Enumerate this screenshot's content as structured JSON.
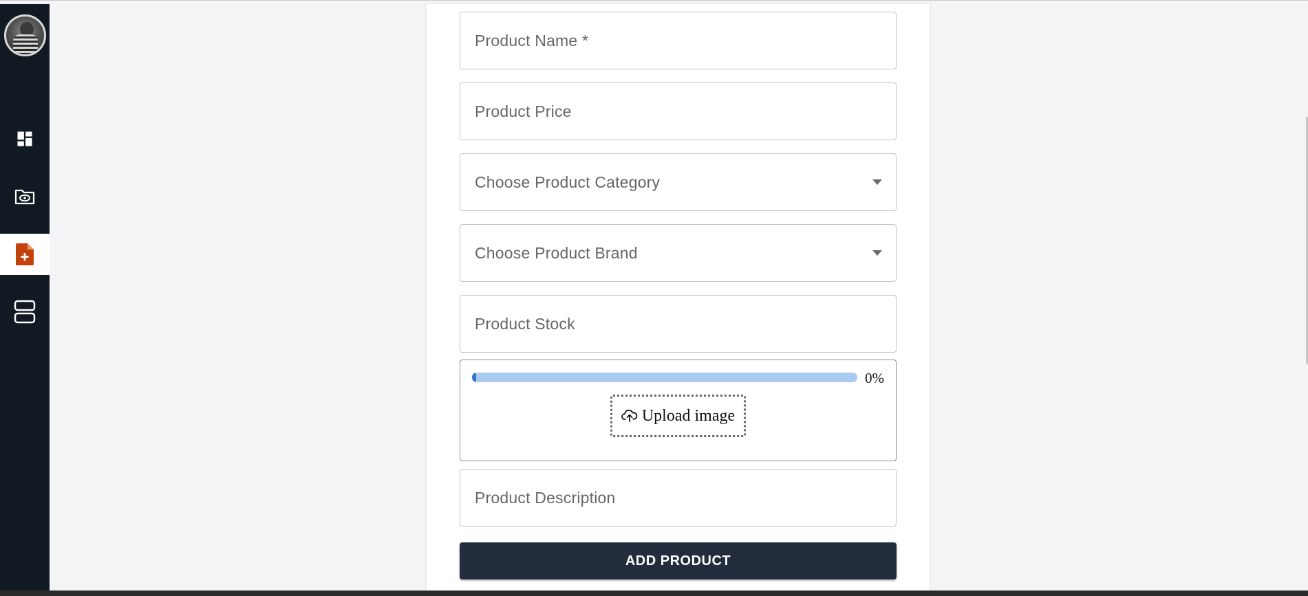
{
  "colors": {
    "sidebar_bg": "#111a22",
    "page_bg": "#f3f4f6",
    "active_icon": "#c2410c",
    "button_bg": "#232d3d",
    "progress_track": "#a9cbef",
    "progress_fill": "#2e73c8"
  },
  "sidebar": {
    "items": [
      {
        "icon": "dashboard-icon",
        "active": false
      },
      {
        "icon": "folder-eye-icon",
        "active": false
      },
      {
        "icon": "add-document-icon",
        "active": true
      },
      {
        "icon": "layout-rows-icon",
        "active": false
      }
    ]
  },
  "form": {
    "product_name_placeholder": "Product Name *",
    "product_price_placeholder": "Product Price",
    "category_placeholder": "Choose Product Category",
    "brand_placeholder": "Choose Product Brand",
    "stock_placeholder": "Product Stock",
    "upload": {
      "progress_text": "0%",
      "progress_value": 0,
      "button_label": "Upload image",
      "button_icon": "cloud-upload-icon"
    },
    "description_placeholder": "Product Description",
    "submit_label": "ADD PRODUCT"
  }
}
